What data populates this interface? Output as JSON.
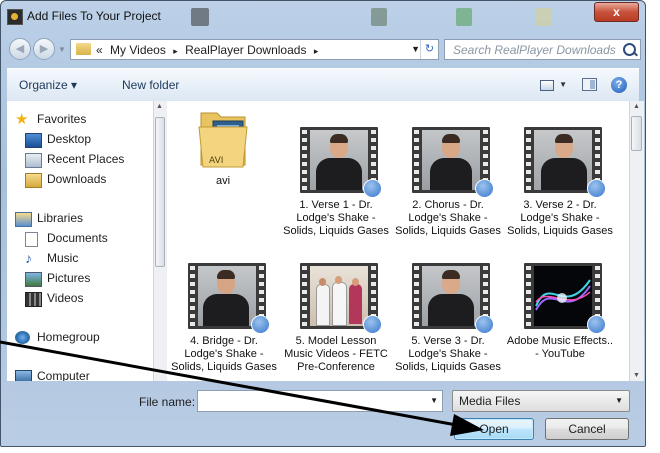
{
  "window": {
    "title": "Add Files To Your Project",
    "close_glyph": "x"
  },
  "address": {
    "overflow": "«",
    "crumbs": [
      "My Videos",
      "RealPlayer Downloads"
    ],
    "separator": "▸",
    "search_placeholder": "Search RealPlayer Downloads"
  },
  "toolbar": {
    "organize": "Organize ▾",
    "new_folder": "New folder",
    "help": "?"
  },
  "nav": {
    "favorites": "Favorites",
    "desktop": "Desktop",
    "recent": "Recent Places",
    "downloads": "Downloads",
    "libraries": "Libraries",
    "documents": "Documents",
    "music": "Music",
    "pictures": "Pictures",
    "videos": "Videos",
    "homegroup": "Homegroup",
    "computer": "Computer"
  },
  "files": [
    {
      "name": "avi",
      "kind": "folder",
      "folder_label": "AVI"
    },
    {
      "name": "1. Verse 1 - Dr. Lodge's Shake - Solids, Liquids Gases",
      "kind": "video-man"
    },
    {
      "name": "2. Chorus - Dr. Lodge's Shake - Solids, Liquids Gases",
      "kind": "video-man"
    },
    {
      "name": "3. Verse 2 - Dr. Lodge's Shake - Solids, Liquids Gases",
      "kind": "video-man"
    },
    {
      "name": "4. Bridge - Dr. Lodge's Shake - Solids, Liquids Gases",
      "kind": "video-man"
    },
    {
      "name": "5. Model Lesson Music Videos - FETC Pre-Conference",
      "kind": "video-group"
    },
    {
      "name": "5. Verse 3 - Dr. Lodge's Shake - Solids, Liquids Gases",
      "kind": "video-man"
    },
    {
      "name": "Adobe Music Effects.. - YouTube",
      "kind": "video-abstract"
    }
  ],
  "bottom": {
    "file_name_label": "File name:",
    "file_name_value": "",
    "filter": "Media Files",
    "open": "Open",
    "cancel": "Cancel"
  },
  "colors": {
    "accent": "#3c7fb1",
    "close": "#c7523b",
    "annotation_arrow": "#000000"
  }
}
